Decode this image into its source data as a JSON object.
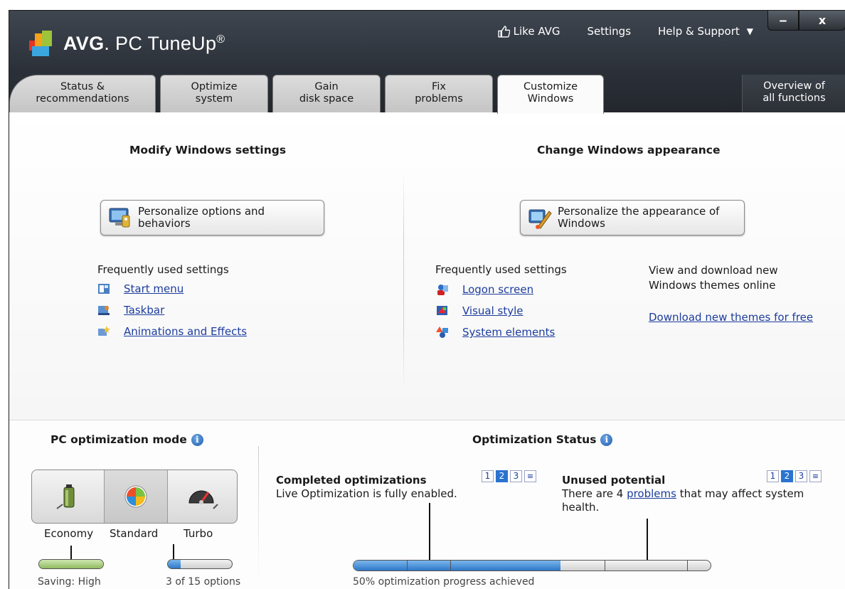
{
  "app": {
    "brand": "AVG",
    "product": "PC TuneUp",
    "trademark": "®"
  },
  "topnav": {
    "like": "Like AVG",
    "settings": "Settings",
    "help": "Help & Support"
  },
  "window_buttons": {
    "minimize": "‒",
    "close": "x"
  },
  "tabs": [
    {
      "line1": "Status &",
      "line2": "recommendations"
    },
    {
      "line1": "Optimize",
      "line2": "system"
    },
    {
      "line1": "Gain",
      "line2": "disk space"
    },
    {
      "line1": "Fix",
      "line2": "problems"
    },
    {
      "line1": "Customize",
      "line2": "Windows",
      "active": true
    }
  ],
  "overview_tab": {
    "line1": "Overview of",
    "line2": "all functions"
  },
  "modify": {
    "title": "Modify Windows settings",
    "button_line1": "Personalize options and",
    "button_line2": "behaviors",
    "freq_label": "Frequently used settings",
    "links": [
      "Start menu",
      "Taskbar",
      "Animations and Effects"
    ]
  },
  "appearance": {
    "title": "Change Windows appearance",
    "button_line1": "Personalize the appearance of",
    "button_line2": "Windows",
    "freq_label": "Frequently used settings",
    "links": [
      "Logon screen",
      "Visual style",
      "System elements"
    ],
    "themes_text_line1": "View and download new",
    "themes_text_line2": "Windows themes online",
    "themes_link": "Download new themes for free"
  },
  "mode": {
    "title": "PC optimization mode",
    "info": "i",
    "labels": [
      "Economy",
      "Standard",
      "Turbo"
    ],
    "selected": "Standard",
    "saving_label": "Saving: High",
    "saving_level": 1.0,
    "turbo_label": "3 of 15 options",
    "turbo_level": 0.2
  },
  "status": {
    "title": "Optimization Status",
    "info": "i",
    "completed_title": "Completed optimizations",
    "completed_text": "Live Optimization is fully enabled.",
    "pager": [
      "1",
      "2",
      "3",
      "≡"
    ],
    "pager_selected": "2",
    "unused_title": "Unused potential",
    "unused_text_pre": "There are 4 ",
    "unused_link": "problems",
    "unused_text_post": " that may affect system",
    "unused_text_line2": "health.",
    "progress_label": "50% optimization progress achieved",
    "progress_fraction": 0.58
  },
  "colors": {
    "link": "#1d3d9e",
    "header": "#2b3038",
    "progress": "#2e78c8",
    "saving": "#a9d08a"
  }
}
